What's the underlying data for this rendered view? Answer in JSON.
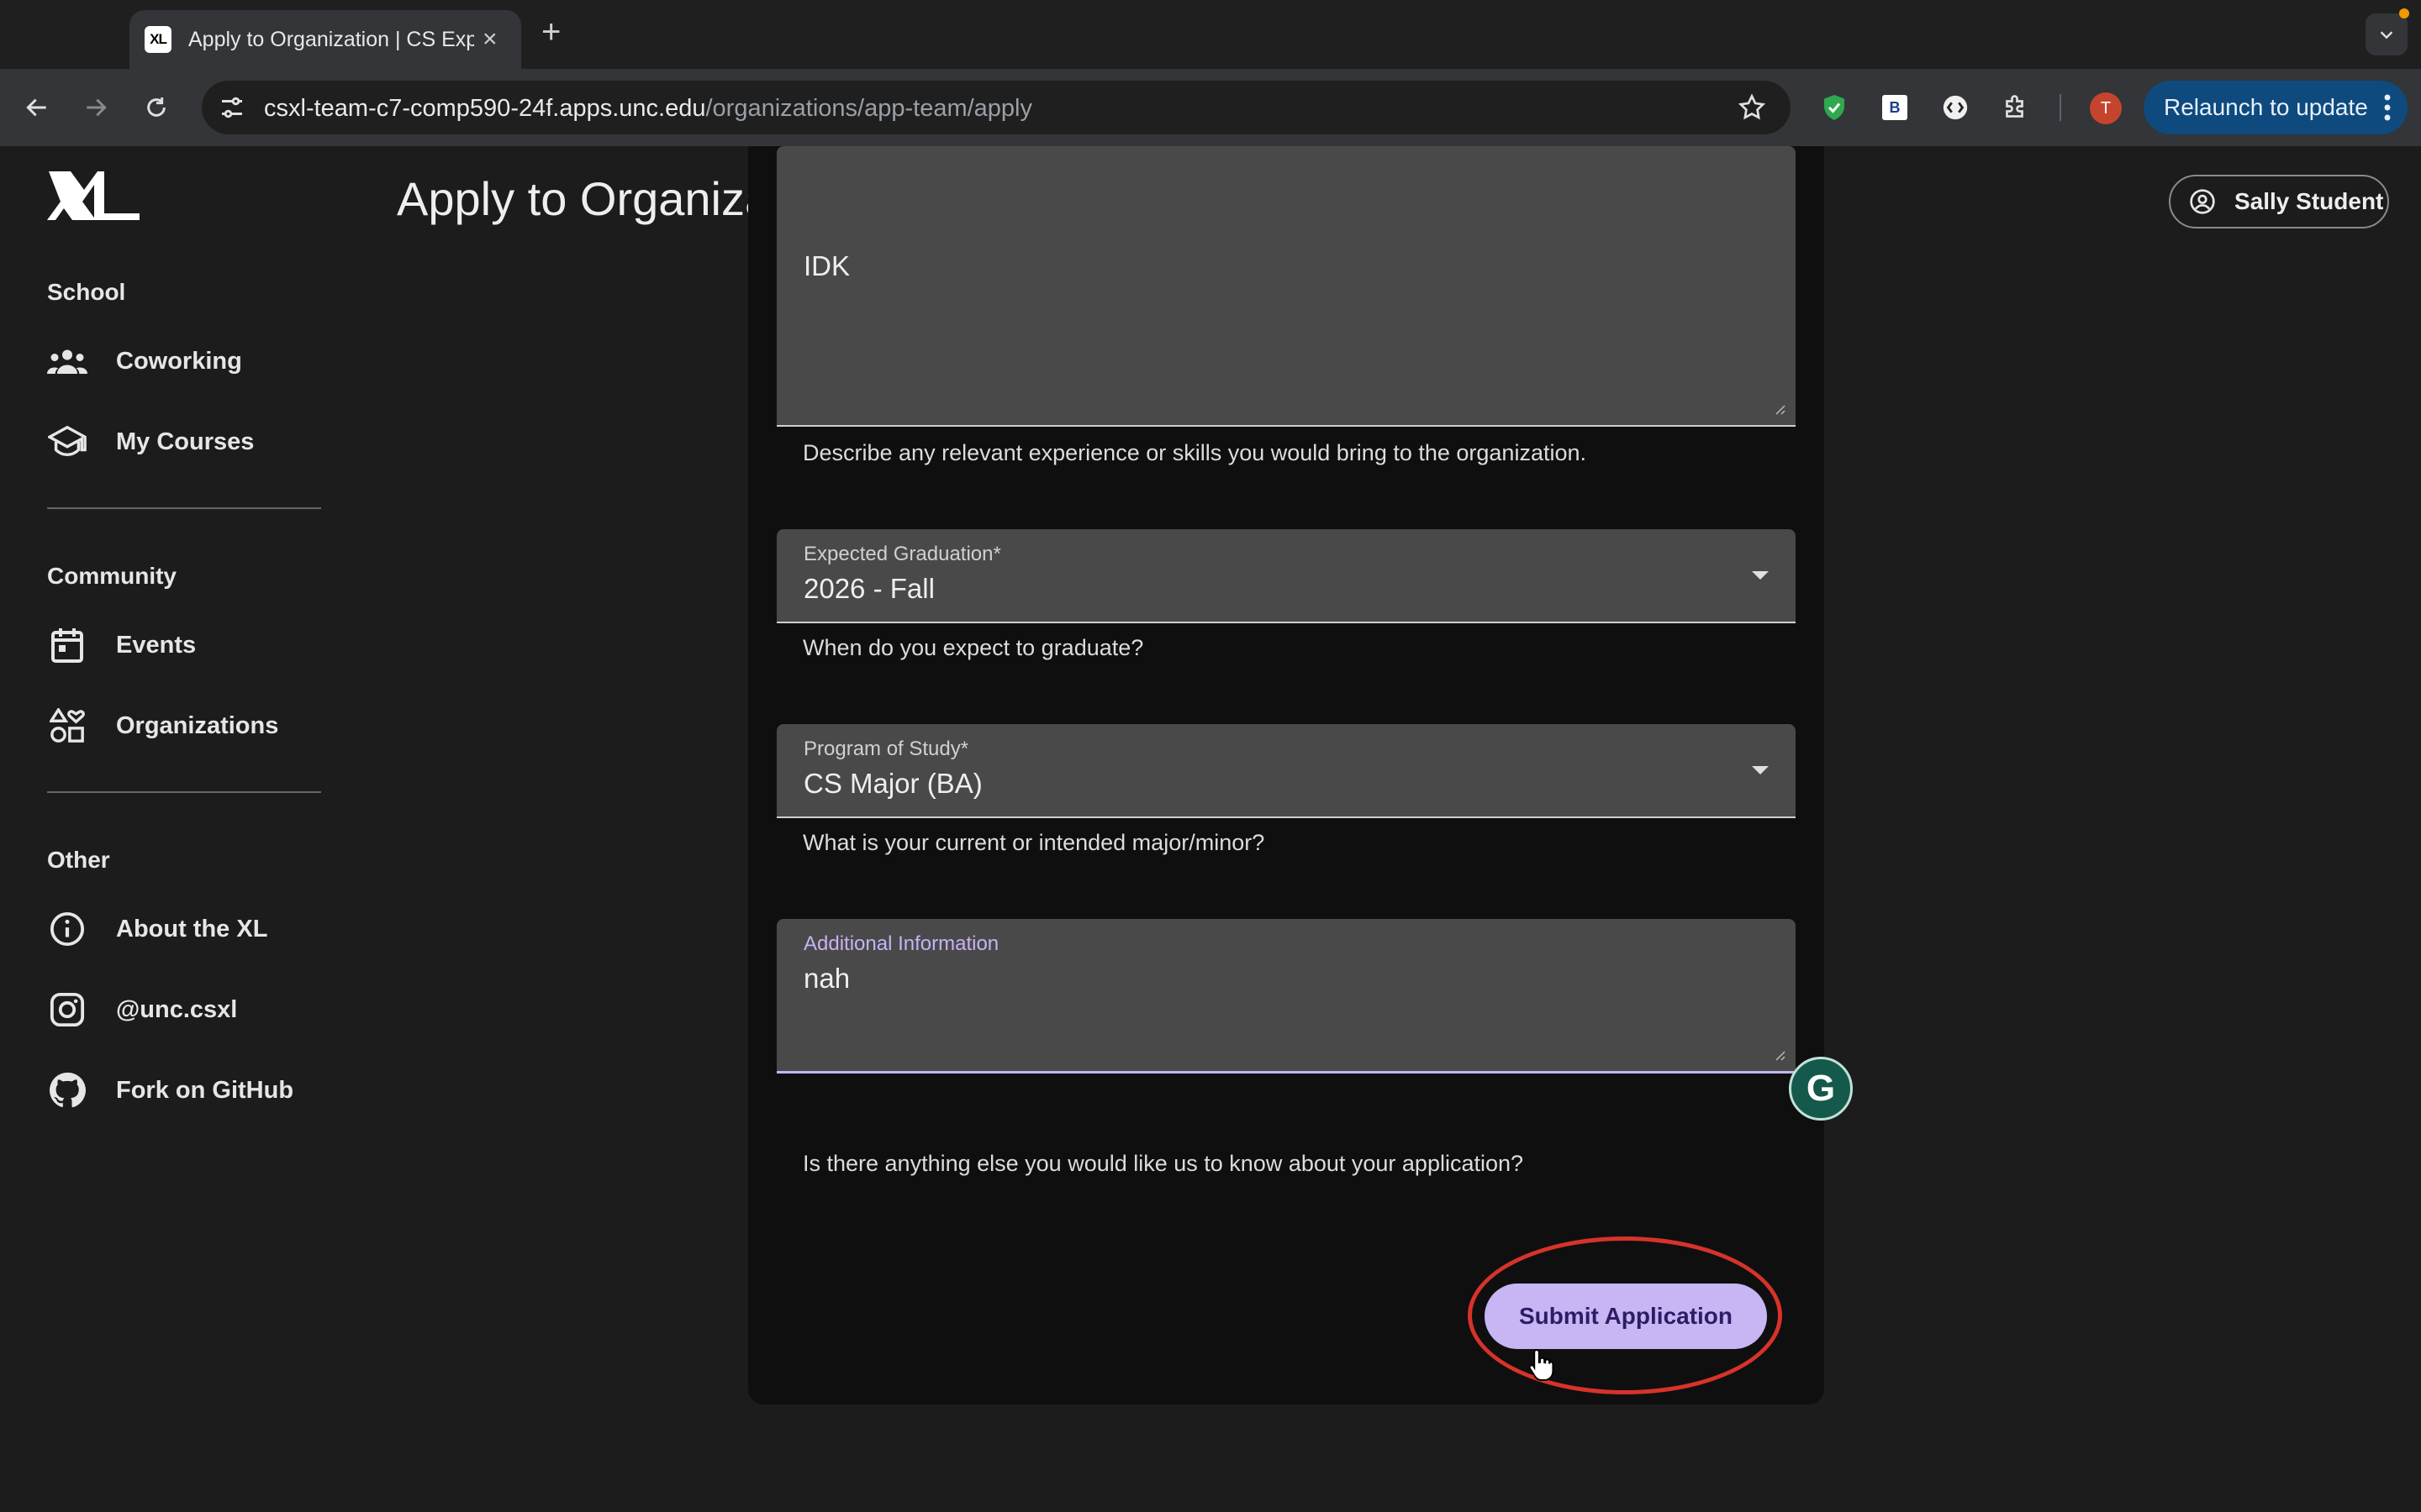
{
  "browser": {
    "tab_title": "Apply to Organization | CS Experience Labs",
    "tab_favicon": "XL",
    "url_host": "csxl-team-c7-comp590-24f.apps.unc.edu",
    "url_path": "/organizations/app-team/apply",
    "extension_b_label": "B",
    "profile_initial": "T",
    "relaunch_label": "Relaunch to update",
    "accent": "#0e4a7d"
  },
  "header": {
    "title": "Apply to Organization",
    "user_name": "Sally Student"
  },
  "sidebar": {
    "sections": [
      {
        "label": "School",
        "items": [
          {
            "label": "Coworking",
            "icon": "people-icon"
          },
          {
            "label": "My Courses",
            "icon": "school-icon"
          }
        ]
      },
      {
        "label": "Community",
        "items": [
          {
            "label": "Events",
            "icon": "calendar-icon"
          },
          {
            "label": "Organizations",
            "icon": "shapes-icon"
          }
        ]
      },
      {
        "label": "Other",
        "items": [
          {
            "label": "About the XL",
            "icon": "info-icon"
          },
          {
            "label": "@unc.csxl",
            "icon": "instagram-icon"
          },
          {
            "label": "Fork on GitHub",
            "icon": "github-icon"
          }
        ]
      }
    ]
  },
  "form": {
    "experience_value": "IDK",
    "experience_hint": "Describe any relevant experience or skills you would bring to the organization.",
    "graduation_label": "Expected Graduation*",
    "graduation_value": "2026 - Fall",
    "graduation_hint": "When do you expect to graduate?",
    "program_label": "Program of Study*",
    "program_value": "CS Major (BA)",
    "program_hint": "What is your current or intended major/minor?",
    "additional_label": "Additional Information",
    "additional_value": "nah",
    "additional_hint": "Is there anything else you would like us to know about your application?",
    "submit_label": "Submit Application",
    "accent": "#c8b5f4",
    "annotation_color": "#d7332a"
  },
  "grammarly_glyph": "G"
}
